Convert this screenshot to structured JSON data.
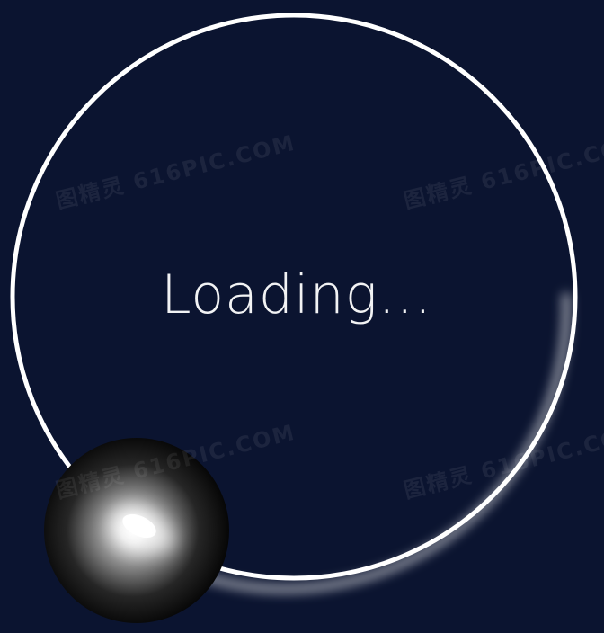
{
  "loader": {
    "text": "Loading...",
    "ring_color": "#ffffff",
    "background_color": "#0b1430"
  },
  "watermark": {
    "text": "图精灵 616PIC.COM"
  }
}
